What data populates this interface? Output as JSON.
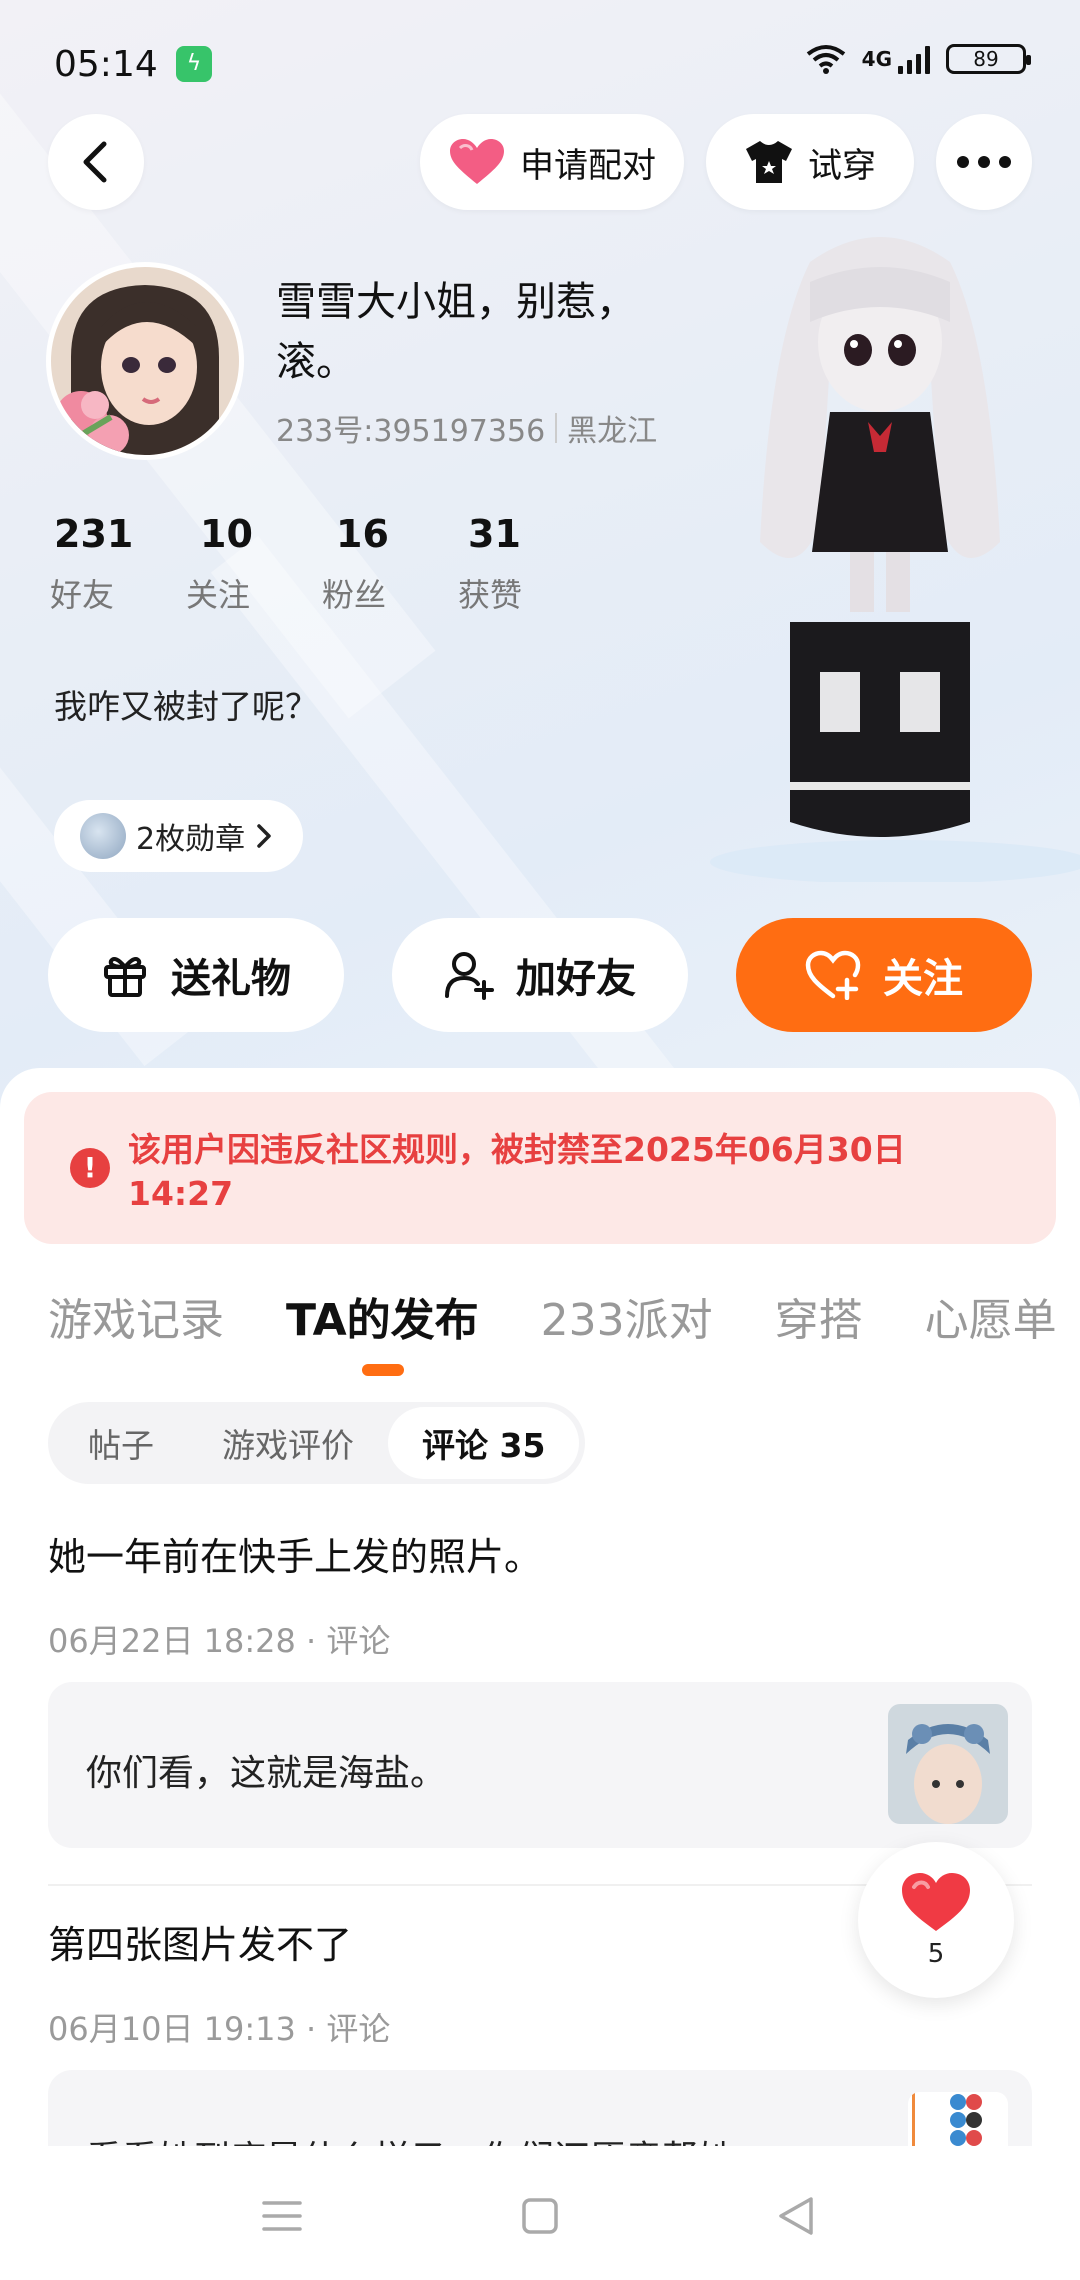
{
  "status_bar": {
    "time": "05:14",
    "network": "4G",
    "battery": "89"
  },
  "top_nav": {
    "match_label": "申请配对",
    "try_on_label": "试穿"
  },
  "profile": {
    "nickname": "雪雪大小姐，别惹，滚。",
    "uid": "233号:395197356",
    "location": "黑龙江",
    "bio": "我咋又被封了呢？",
    "badges_label": "2枚勋章"
  },
  "stats": [
    {
      "num": "231",
      "label": "好友"
    },
    {
      "num": "10",
      "label": "关注"
    },
    {
      "num": "16",
      "label": "粉丝"
    },
    {
      "num": "31",
      "label": "获赞"
    }
  ],
  "actions": {
    "gift": "送礼物",
    "add_friend": "加好友",
    "follow": "关注"
  },
  "ban_notice": {
    "line1": "该用户因违反社区规则，被封禁至2025年06月30日",
    "line2": "14:27"
  },
  "tabs": [
    {
      "label": "游戏记录"
    },
    {
      "label": "TA的发布"
    },
    {
      "label": "233派对"
    },
    {
      "label": "穿搭"
    },
    {
      "label": "心愿单"
    }
  ],
  "subtabs": [
    {
      "label": "帖子"
    },
    {
      "label": "游戏评价"
    },
    {
      "label": "评论 35"
    }
  ],
  "posts": [
    {
      "title": "她一年前在快手上发的照片。",
      "meta": "06月22日 18:28 · 评论",
      "quote": "你们看，这就是海盐。"
    },
    {
      "title": "第四张图片发不了",
      "meta": "06月10日 19:13 · 评论",
      "quote": "看看她到底是什么样子，你们还愿意帮她..."
    }
  ],
  "like_count": "5",
  "colors": {
    "accent": "#ff6d12",
    "ban_text": "#e74040",
    "ban_bg": "#fde8e6"
  }
}
